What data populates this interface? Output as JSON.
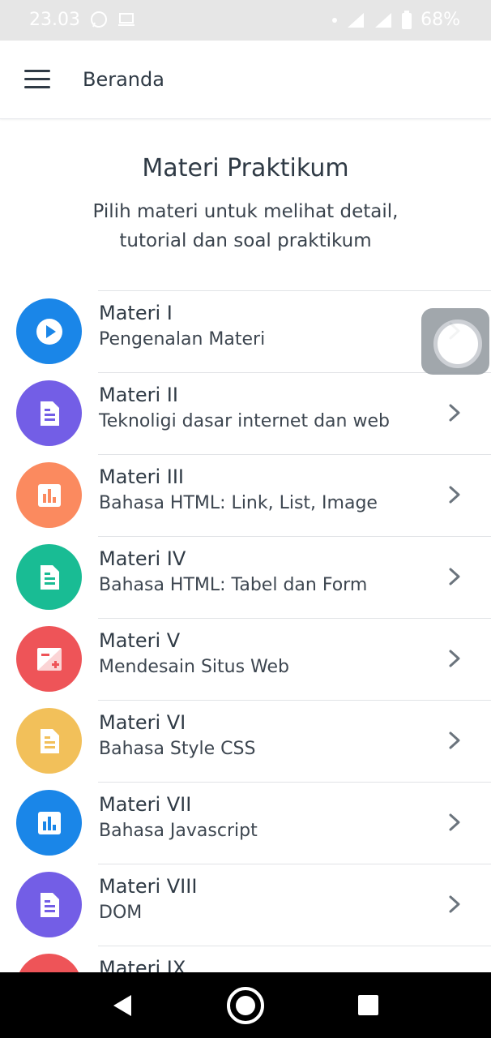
{
  "status_bar": {
    "time": "23.03",
    "battery": "68%"
  },
  "app_bar": {
    "title": "Beranda",
    "menu_icon": "menu-icon"
  },
  "header": {
    "title": "Materi Praktikum",
    "subtitle_line1": "Pilih materi untuk melihat detail,",
    "subtitle_line2": "tutorial dan soal praktikum"
  },
  "items": [
    {
      "title": "Materi I",
      "subtitle": "Pengenalan Materi",
      "color": "#1a86e8",
      "icon": "play-icon"
    },
    {
      "title": "Materi II",
      "subtitle": "Teknoligi dasar internet dan web",
      "color": "#735ee6",
      "icon": "document-icon"
    },
    {
      "title": "Materi III",
      "subtitle": "Bahasa HTML: Link, List, Image",
      "color": "#fb8a5f",
      "icon": "bar-chart-icon"
    },
    {
      "title": "Materi IV",
      "subtitle": "Bahasa HTML: Tabel dan Form",
      "color": "#19bc94",
      "icon": "document-icon"
    },
    {
      "title": "Materi V",
      "subtitle": "Mendesain Situs Web",
      "color": "#ee5458",
      "icon": "image-plus-icon"
    },
    {
      "title": "Materi VI",
      "subtitle": "Bahasa Style CSS",
      "color": "#f2c05a",
      "icon": "document-icon"
    },
    {
      "title": "Materi VII",
      "subtitle": "Bahasa Javascript",
      "color": "#1a86e8",
      "icon": "bar-chart-icon"
    },
    {
      "title": "Materi VIII",
      "subtitle": "DOM",
      "color": "#735ee6",
      "icon": "document-icon"
    },
    {
      "title": "Materi IX",
      "subtitle": "",
      "color": "#ee5458",
      "icon": "image-plus-icon"
    }
  ]
}
